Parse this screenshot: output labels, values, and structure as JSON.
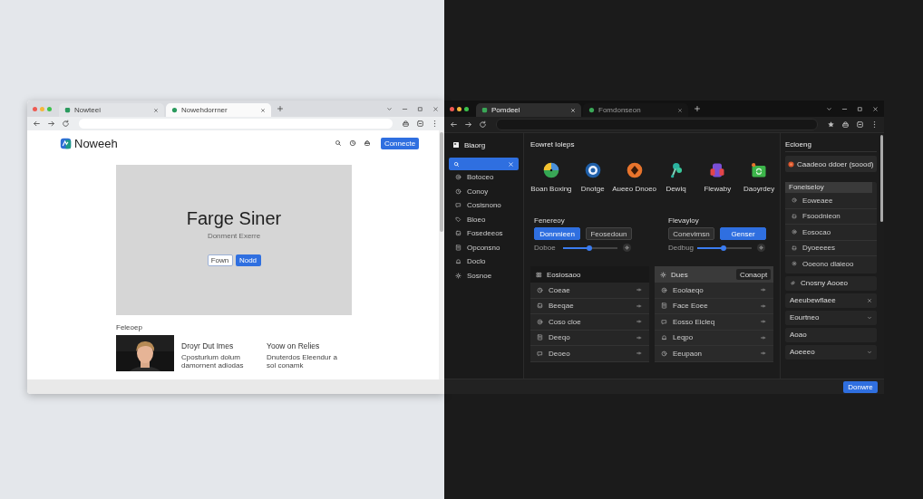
{
  "light_browser": {
    "tabs": [
      {
        "title": "Nowteei",
        "selected": false
      },
      {
        "title": "Nowehdorrner",
        "selected": true
      }
    ],
    "site": {
      "brand": "Noweeh",
      "header_button": "Connecte",
      "hero": {
        "title": "Farge Siner",
        "subtitle": "Donment Exerre",
        "buttons": [
          {
            "label": "Fown",
            "kind": "secondary"
          },
          {
            "label": "Nodd",
            "kind": "primary"
          }
        ]
      },
      "section_label": "Feleoep",
      "articles": [
        {
          "title": "Droyr Dut Imes",
          "text": "Cposturlum dolum damornent adiodas"
        },
        {
          "title": "Yoow on Relies",
          "text": "Dnuterdos Eleendur a sol conamk"
        }
      ]
    }
  },
  "dark_browser": {
    "tabs": [
      {
        "title": "Pomdeel",
        "selected": true
      },
      {
        "title": "Fomdonseon",
        "selected": false
      }
    ],
    "sidebar": {
      "title": "Blaorg",
      "items": [
        "Botoceo",
        "Conoy",
        "Cosisnono",
        "Bloeo",
        "Fosedeeos",
        "Opconsno",
        "Doclo",
        "Sosnoe"
      ]
    },
    "main": {
      "title": "Eowret Ioleps",
      "apps": [
        "Boan Boxing",
        "Dnotge",
        "Aueeo Dnoeo",
        "Dewiq",
        "Flewaby",
        "Daoyrdey"
      ],
      "control_groups": [
        {
          "label": "Fenereoy",
          "buttons": [
            {
              "label": "Donnnieen",
              "selected": true
            },
            {
              "label": "Feosedoun",
              "selected": false
            }
          ],
          "slider": {
            "label": "Doboe",
            "level": 0.49
          }
        },
        {
          "label": "Flevayloy",
          "buttons": [
            {
              "label": "Conevirnsn",
              "selected": false
            },
            {
              "label": "Genser",
              "selected": true
            }
          ],
          "slider": {
            "label": "Dedbug",
            "level": 0.49
          }
        }
      ],
      "lists": [
        {
          "header": "Eosiosaoo",
          "rows": [
            "Coeae",
            "Beeqae",
            "Coso cloe",
            "Deeqo",
            "Deoeo"
          ]
        },
        {
          "header": "Dues",
          "header_button": "Conaopt",
          "rows": [
            "Eoolaeqo",
            "Face Eoee",
            "Eosso Eicleq",
            "Leqpo",
            "Eeupaon"
          ]
        }
      ]
    },
    "right_panel": {
      "title": "Ecioeng",
      "profile": "Caadeoo ddoer (soood)",
      "menu": {
        "header": "Foneiseloy",
        "items": [
          "Eoweaee",
          "Fsoodnieon",
          "Eosocao",
          "Dyoeeees",
          "Ooeono dlaieoo"
        ]
      },
      "rows": [
        {
          "label": "Cnosny Aooeo",
          "kind": "link"
        },
        {
          "label": "Aeeubewflaee",
          "kind": "clear"
        },
        {
          "label": "Eourtneo",
          "kind": "dropdown"
        },
        {
          "label": "Aoao",
          "kind": "plain"
        },
        {
          "label": "Aoeeeo",
          "kind": "dropdown"
        }
      ]
    },
    "footer_button": "Donwre"
  }
}
